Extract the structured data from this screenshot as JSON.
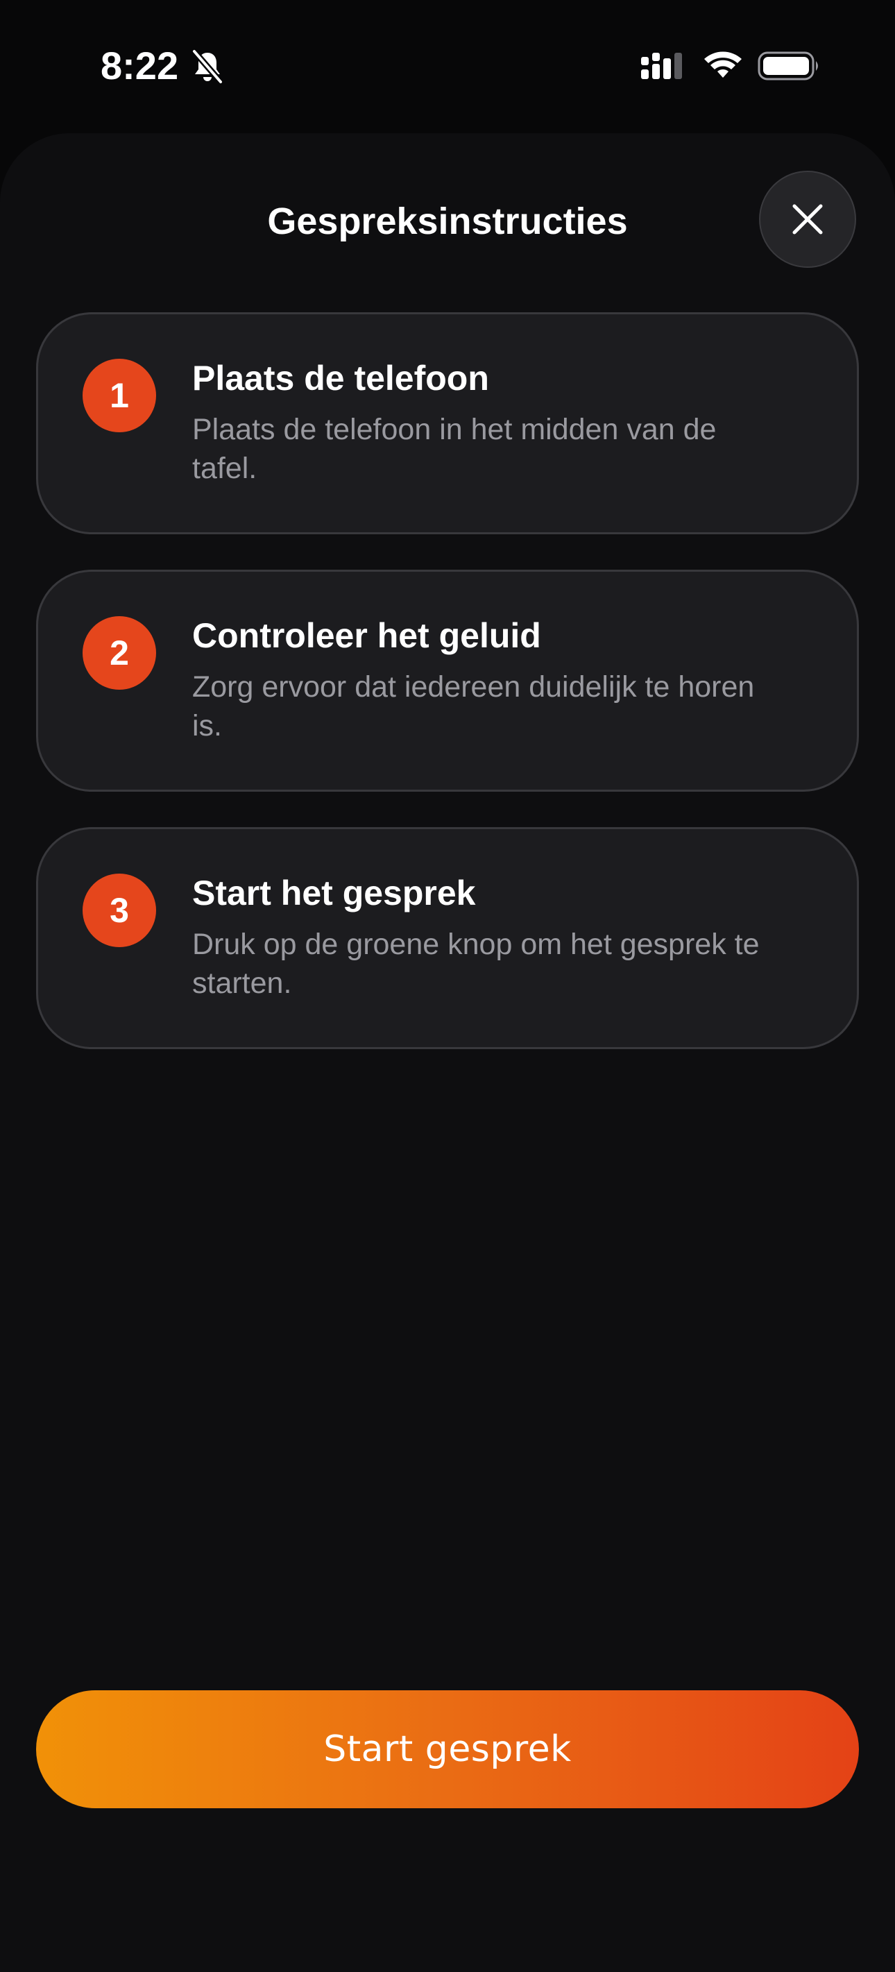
{
  "status_bar": {
    "time": "8:22",
    "icons": [
      "bell-slash-icon",
      "cellular-signal-icon",
      "wifi-icon",
      "battery-icon"
    ]
  },
  "sheet": {
    "title": "Gespreksinstructies",
    "close_icon": "close-icon"
  },
  "steps": [
    {
      "number": "1",
      "title": "Plaats de telefoon",
      "description": "Plaats de telefoon in het midden van de tafel."
    },
    {
      "number": "2",
      "title": "Controleer het geluid",
      "description": "Zorg ervoor dat iedereen duidelijk te horen is."
    },
    {
      "number": "3",
      "title": "Start het gesprek",
      "description": "Druk op de groene knop om het gesprek te starten."
    }
  ],
  "start_button": {
    "label": "Start gesprek"
  },
  "colors": {
    "accent": "#e5461c",
    "gradient_start": "#f19108",
    "gradient_end": "#e44216",
    "card_background": "#1c1c1f",
    "sheet_background": "#0e0e10"
  }
}
